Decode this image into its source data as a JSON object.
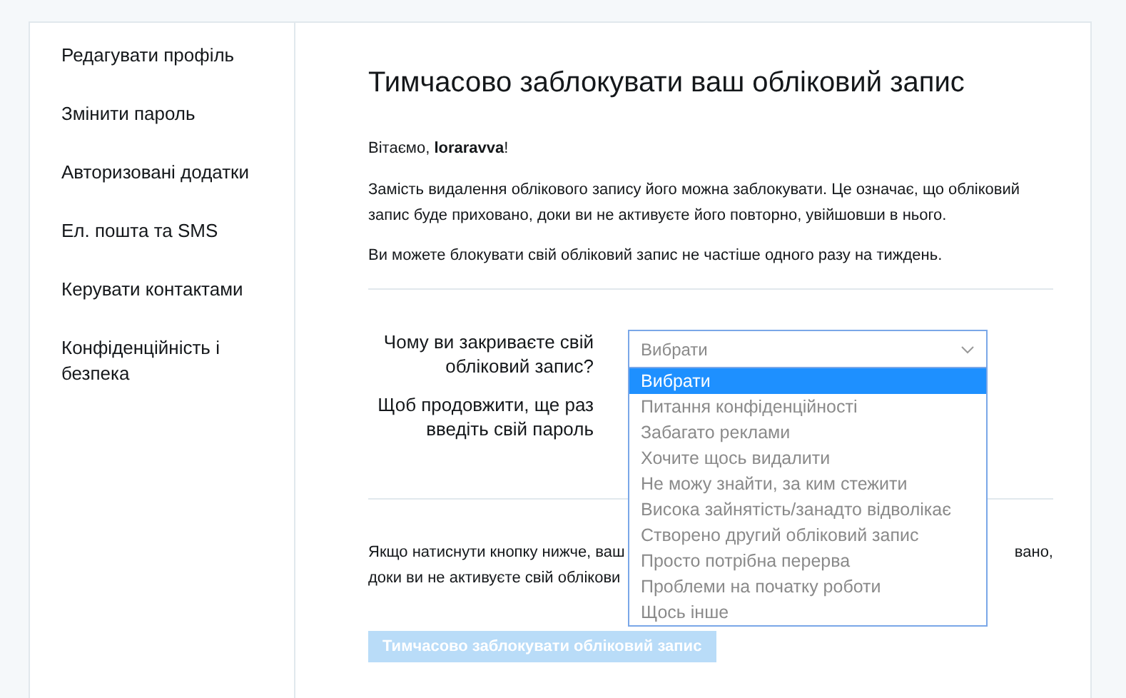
{
  "sidebar": {
    "items": [
      {
        "label": "Редагувати профіль",
        "selected": false
      },
      {
        "label": "Змінити пароль",
        "selected": false
      },
      {
        "label": "Авторизовані додатки",
        "selected": false
      },
      {
        "label": "Ел. пошта та SMS",
        "selected": false
      },
      {
        "label": "Керувати контактами",
        "selected": false
      },
      {
        "label": "Конфіденційність і безпека",
        "selected": false
      }
    ]
  },
  "title": "Тимчасово заблокувати ваш обліковий запис",
  "greeting": "Вітаємо, **loraravva**!",
  "paragraphs": [
    "Замість видалення облікового запису його можна заблокувати. Це означає, що обліковий запис буде приховано, доки ви не активуєте його повторно, увійшовши в нього.",
    "Ви можете блокувати свій обліковий запис не частіше одного разу на тиждень."
  ],
  "form": {
    "reason_label": "Чому ви закриваєте свій обліковий запис?",
    "password_label": "Щоб продовжити, ще раз введіть свій пароль",
    "select": {
      "value": "Вибрати",
      "expanded": true,
      "options": [
        {
          "label": "Вибрати",
          "selected": true
        },
        {
          "label": "Питання конфіденційності",
          "selected": false
        },
        {
          "label": "Забагато реклами",
          "selected": false
        },
        {
          "label": "Хочите щось видалити",
          "selected": false
        },
        {
          "label": "Не можу знайти, за ким стежити",
          "selected": false
        },
        {
          "label": "Висока зайнятість/занадто відволікає",
          "selected": false
        },
        {
          "label": "Створено другий обліковий запис",
          "selected": false
        },
        {
          "label": "Просто потрібна перерва",
          "selected": false
        },
        {
          "label": "Проблеми на початку роботи",
          "selected": false
        },
        {
          "label": "Щось інше",
          "selected": false
        }
      ]
    }
  },
  "notice": {
    "line_1_start": "Якщо натиснути кнопку нижче, ваш",
    "line_1_end": "вано,",
    "line_2_start": "доки ви не активуєте свій облікови"
  },
  "submit": {
    "label": "Тимчасово заблокувати обліковий запис",
    "disabled": true
  }
}
